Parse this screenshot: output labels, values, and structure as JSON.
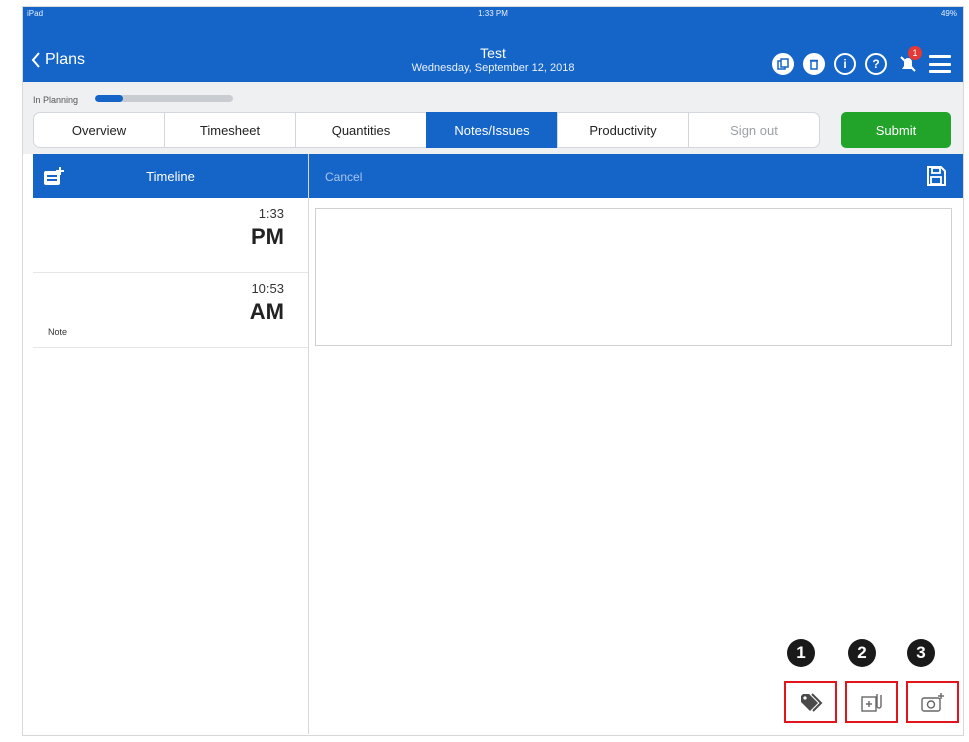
{
  "status": {
    "carrier": "iPad",
    "time": "1:33 PM",
    "battery": "49%"
  },
  "header": {
    "back_label": "Plans",
    "title": "Test",
    "subtitle": "Wednesday, September 12, 2018",
    "notification_count": "1",
    "accent_color": "#1565c8"
  },
  "progress": {
    "label": "In Planning",
    "value_percent": 20
  },
  "tabs": [
    {
      "label": "Overview"
    },
    {
      "label": "Timesheet"
    },
    {
      "label": "Quantities"
    },
    {
      "label": "Notes/Issues",
      "active": true
    },
    {
      "label": "Productivity"
    },
    {
      "label": "Sign out"
    }
  ],
  "submit_label": "Submit",
  "timeline": {
    "title": "Timeline",
    "entries": [
      {
        "time": "1:33",
        "ampm": "PM",
        "label": ""
      },
      {
        "time": "10:53",
        "ampm": "AM",
        "label": "Note"
      }
    ]
  },
  "editor": {
    "cancel_label": "Cancel",
    "note_value": ""
  },
  "callouts": [
    "1",
    "2",
    "3"
  ],
  "tools": [
    {
      "icon": "tag-icon"
    },
    {
      "icon": "attach-file-icon"
    },
    {
      "icon": "add-photo-icon"
    }
  ]
}
